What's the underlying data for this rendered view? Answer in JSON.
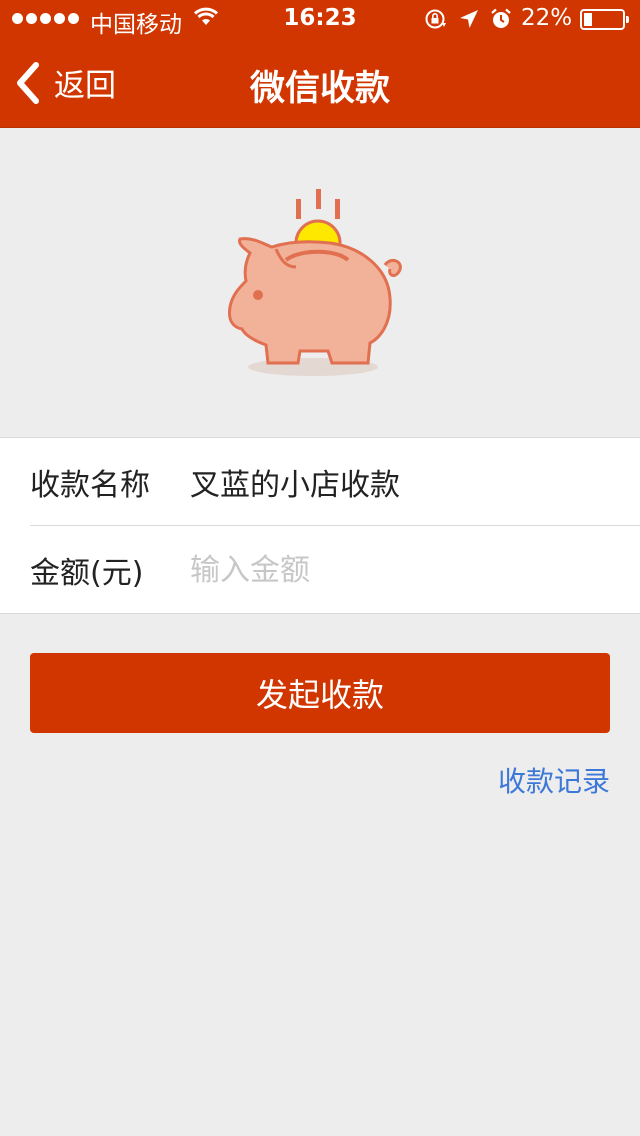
{
  "status_bar": {
    "carrier": "中国移动",
    "time": "16:23",
    "battery_percent": "22%",
    "battery_level": 0.22,
    "icons": [
      "signal-dots-icon",
      "wifi-icon",
      "rotation-lock-icon",
      "location-arrow-icon",
      "alarm-icon",
      "battery-icon"
    ]
  },
  "nav": {
    "back_label": "返回",
    "title": "微信收款"
  },
  "hero": {
    "illustration": "piggy-bank-icon"
  },
  "form": {
    "name_label": "收款名称",
    "name_value": "叉蓝的小店收款",
    "amount_label": "金额(元)",
    "amount_placeholder": "输入金额",
    "amount_value": ""
  },
  "actions": {
    "submit_label": "发起收款",
    "records_link": "收款记录"
  },
  "colors": {
    "brand": "#d13600",
    "link": "#3c78d8",
    "background": "#ededed",
    "pig_body": "#f2b199",
    "pig_outline": "#e07050",
    "coin": "#ffe800"
  }
}
